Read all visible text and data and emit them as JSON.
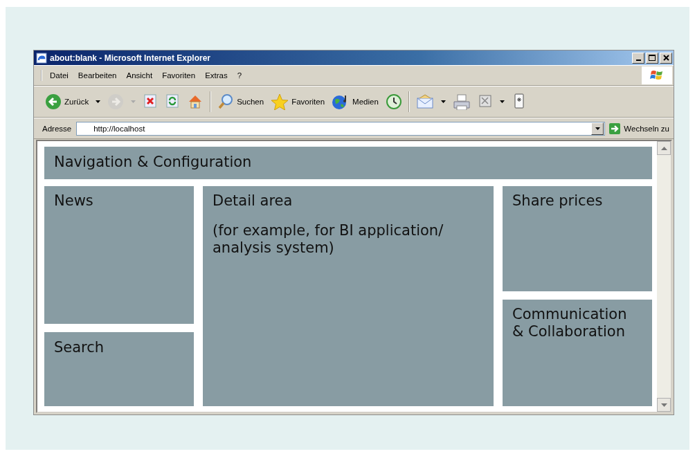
{
  "window": {
    "title": "about:blank - Microsoft Internet Explorer"
  },
  "menu": [
    "Datei",
    "Bearbeiten",
    "Ansicht",
    "Favoriten",
    "Extras",
    "?"
  ],
  "toolbar": [
    {
      "kind": "button",
      "label": "Zurück",
      "dropdown": true,
      "disabled": false
    },
    {
      "kind": "button",
      "dropdown": true,
      "disabled": true
    },
    {
      "kind": "button",
      "dropdown": false,
      "disabled": false
    },
    {
      "kind": "button",
      "dropdown": false,
      "disabled": false
    },
    {
      "kind": "button",
      "dropdown": false,
      "disabled": false
    },
    {
      "kind": "separator"
    },
    {
      "kind": "button",
      "label": "Suchen",
      "dropdown": false,
      "disabled": false
    },
    {
      "kind": "button",
      "label": "Favoriten",
      "dropdown": false,
      "disabled": false
    },
    {
      "kind": "button",
      "label": "Medien",
      "dropdown": false,
      "disabled": false
    },
    {
      "kind": "button",
      "dropdown": false,
      "disabled": false
    },
    {
      "kind": "separator"
    },
    {
      "kind": "button",
      "dropdown": true,
      "disabled": false
    },
    {
      "kind": "button",
      "dropdown": false,
      "disabled": false
    },
    {
      "kind": "button",
      "dropdown": true,
      "disabled": false
    },
    {
      "kind": "button",
      "dropdown": false,
      "disabled": false
    }
  ],
  "address": {
    "label": "Adresse",
    "value": "http://localhost",
    "go": "Wechseln zu"
  },
  "page": {
    "header": {
      "title": "Navigation & Configuration"
    },
    "left": [
      {
        "title": "News"
      },
      {
        "title": "Search"
      }
    ],
    "center": {
      "title": "Detail area",
      "text": "(for example, for BI application/ analysis system)"
    },
    "right": [
      {
        "title": "Share prices"
      },
      {
        "title": "Communication & Collaboration"
      }
    ]
  }
}
